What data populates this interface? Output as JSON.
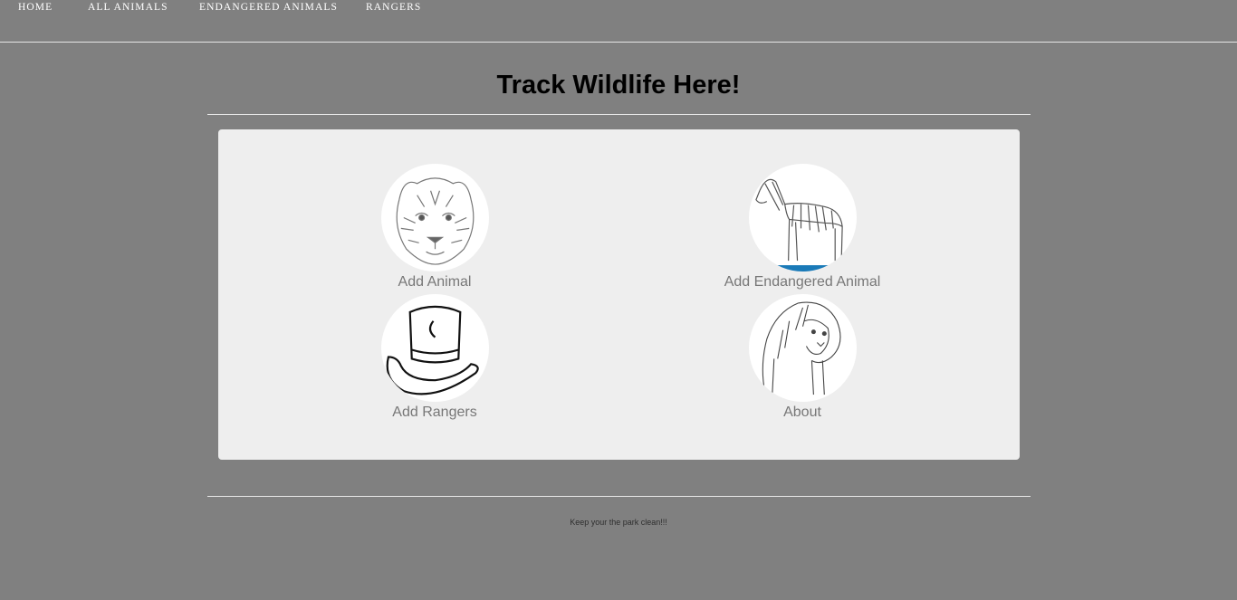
{
  "nav": {
    "items": [
      {
        "label": "HOME"
      },
      {
        "label": "ALL ANIMALS"
      },
      {
        "label": "ENDANGERED ANIMALS"
      },
      {
        "label": "RANGERS"
      }
    ]
  },
  "header": {
    "title": "Track Wildlife Here!"
  },
  "tiles": [
    {
      "label": "Add Animal",
      "icon": "tiger-icon"
    },
    {
      "label": "Add Endangered Animal",
      "icon": "zebra-icon"
    },
    {
      "label": "Add Rangers",
      "icon": "cowboy-hat-icon"
    },
    {
      "label": "About",
      "icon": "lion-icon"
    }
  ],
  "footer": {
    "text": "Keep your the park clean!!!"
  },
  "colors": {
    "background": "#808080",
    "panel": "#eeeeee",
    "accent": "#1a7ab8"
  }
}
